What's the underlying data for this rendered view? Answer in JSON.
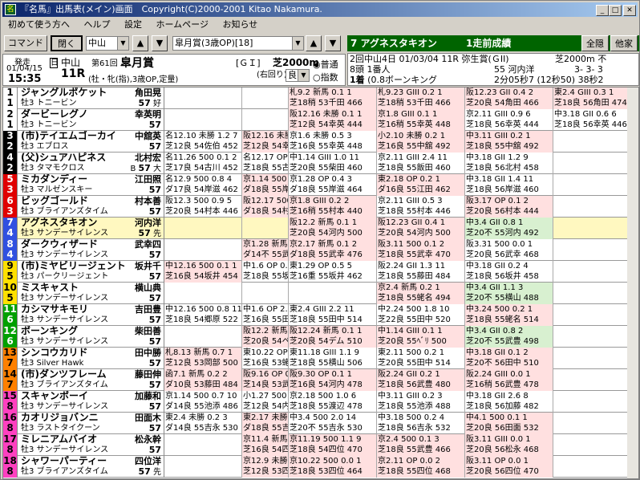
{
  "window": {
    "title": "『名馬』出馬表(メイン)画面　Copyright(C)2000-2001 Kitao Nakamura.",
    "icon": "名"
  },
  "menu": [
    "初めて使う方へ",
    "ヘルプ",
    "設定",
    "ホームページ",
    "お知らせ"
  ],
  "toolbar": {
    "command": "コマンド",
    "close": "閉く",
    "course": "中山",
    "race": "皐月賞(3歳OP)[18]"
  },
  "race": {
    "hassou_label": "発走",
    "date": "01/04/15",
    "time": "15:35",
    "place": "中山",
    "kai": "第61回",
    "name": "皐月賞",
    "day_label": "日",
    "day_value": "11R",
    "grade": "[ＧＩ]",
    "dist": "芝2000m",
    "turn": "(右回り)",
    "cond": "(牡・牝(指),3歳OP,定量)",
    "baba": "良",
    "radio1": "普通",
    "radio2": "指数"
  },
  "horse": {
    "header": "7 アグネスタキオン",
    "result": "1走前成績",
    "btn1": "全隠",
    "btn2": "他家",
    "l1a": "2回中山4日 01/03/04 11R 弥生賞(ＧII)",
    "l1b": "芝2000m 不",
    "l2a": "8頭 1番人",
    "l2b": "55 河内洋",
    "l2c": "3- 3- 3",
    "l3a": "1着",
    "l3b": "(0.8ボーンキング",
    "l3c": "2分05秒7 (12秒50) 38秒2"
  },
  "rows": [
    {
      "no": "1",
      "ban": "1",
      "bc": "#ffffff",
      "fc": "#000000",
      "name": "ジャングルポケット",
      "sex": "牡3 トニービン",
      "jockey": "角田晃",
      "wt": "57",
      "pop": "好",
      "w": "",
      "p": [
        {
          "c": "",
          "a": "",
          "b": ""
        },
        {
          "c": "",
          "a": "",
          "b": ""
        },
        {
          "c": "#ffe0e0",
          "a": "札9.2 新馬 0.1 1",
          "b": "芝18稍 53千田 466"
        },
        {
          "c": "#ffe0e0",
          "a": "札9.23 GIII 0.2 1",
          "b": "芝18稍 53千田 466"
        },
        {
          "c": "#ffe0e0",
          "a": "阪12.23 GII 0.4 2",
          "b": "芝20良 54角田 466"
        },
        {
          "c": "#ffe0e0",
          "a": "東2.4 GIII 0.3 1",
          "b": "芝18良 56角田 474"
        }
      ]
    },
    {
      "no": "2",
      "ban": "1",
      "bc": "#ffffff",
      "fc": "#000000",
      "name": "ダービーレグノ",
      "sex": "牡3 トニービン",
      "jockey": "幸英明",
      "wt": "57",
      "pop": "",
      "w": "",
      "p": [
        {
          "c": "",
          "a": "",
          "b": ""
        },
        {
          "c": "",
          "a": "",
          "b": ""
        },
        {
          "c": "#ffe0e0",
          "a": "阪12.16 未勝 0.1 1",
          "b": "芝12良 54幸英 444"
        },
        {
          "c": "#ffe0e0",
          "a": "京1.8 GIII 0.1 1",
          "b": "芝16稍 55幸英 448"
        },
        {
          "c": "",
          "a": "京2.11 GIII 0.9 6",
          "b": "芝18良 56幸英 444"
        },
        {
          "c": "",
          "a": "中3.18 GII 0.6 6",
          "b": "芝18良 56幸英 446"
        }
      ]
    },
    {
      "no": "3",
      "ban": "2",
      "bc": "#000000",
      "fc": "#ffffff",
      "name": "(市)テイエムゴーカイ",
      "sex": "牡3 エブロス",
      "jockey": "中舘英",
      "wt": "57",
      "pop": "",
      "w": "",
      "p": [
        {
          "c": "",
          "a": "名12.10 未勝 1.2 7",
          "b": "芝12良 54佐伯 452"
        },
        {
          "c": "#ffe0e0",
          "a": "阪12.16 未勝 0.1 1",
          "b": "芝12良 54幸英 444"
        },
        {
          "c": "",
          "a": "京1.6 未勝 0.5 3",
          "b": "芝16良 55幸英 448"
        },
        {
          "c": "#ffe0e0",
          "a": "小2.10 未勝 0.2 1",
          "b": "芝16良 55中舘 492"
        },
        {
          "c": "#ffe0e0",
          "a": "中3.11 GIII 0.2 1",
          "b": "芝18良 55中舘 492"
        },
        {
          "c": "",
          "a": "",
          "b": ""
        }
      ]
    },
    {
      "no": "4",
      "ban": "2",
      "bc": "#000000",
      "fc": "#ffffff",
      "name": "(父)シュアハピネス",
      "sex": "牡3 タマモクロス",
      "jockey": "北村宏",
      "wt": "57",
      "pop": "大",
      "w": "B",
      "p": [
        {
          "c": "",
          "a": "名11.26 500 0.1 2",
          "b": "芝17良 54古川 452"
        },
        {
          "c": "",
          "a": "名12.17 OP 1.0 12",
          "b": "芝18良 55古川 460"
        },
        {
          "c": "",
          "a": "中1.14 GIII 1.0 11",
          "b": "芝20良 55柴田 460"
        },
        {
          "c": "",
          "a": "京2.11 GIII 2.4 11",
          "b": "芝18良 55飯田 460"
        },
        {
          "c": "",
          "a": "中3.18 GII 1.2 9",
          "b": "芝18良 56北村 458"
        },
        {
          "c": "",
          "a": "",
          "b": ""
        }
      ]
    },
    {
      "no": "5",
      "ban": "3",
      "bc": "#e00000",
      "fc": "#ffffff",
      "name": "ミカダンディー",
      "sex": "牡3 マルゼンスキー",
      "jockey": "江田照",
      "wt": "57",
      "pop": "",
      "w": "",
      "p": [
        {
          "c": "",
          "a": "名12.9 500 0.8 4",
          "b": "ダ17良 54岸滋 462"
        },
        {
          "c": "#ffe0e0",
          "a": "京1.14 500 0.0 1",
          "b": "ダ18良 55岸滋 468"
        },
        {
          "c": "",
          "a": "京1.28 OP 0.4 3",
          "b": "ダ18良 55岸滋 464"
        },
        {
          "c": "#ffe0e0",
          "a": "東2.18 OP 0.2 1",
          "b": "ダ16良 55江田 462"
        },
        {
          "c": "",
          "a": "中3.18 GII 1.4 11",
          "b": "芝18良 56岸滋 460"
        },
        {
          "c": "",
          "a": "",
          "b": ""
        }
      ]
    },
    {
      "no": "6",
      "ban": "3",
      "bc": "#e00000",
      "fc": "#ffffff",
      "name": "ビッグゴールド",
      "sex": "牡3 ブライアンズタイム",
      "jockey": "村本善",
      "wt": "57",
      "pop": "",
      "w": "",
      "p": [
        {
          "c": "",
          "a": "阪12.3 500 0.9 5",
          "b": "芝20良 54村本 446"
        },
        {
          "c": "#ffe0e0",
          "a": "阪12.17 500 0.2 1",
          "b": "ダ18良 54村本 448"
        },
        {
          "c": "#ffe0e0",
          "a": "京1.8 GIII 0.2 2",
          "b": "芝16稍 55村本 440"
        },
        {
          "c": "",
          "a": "京2.11 GIII 0.5 3",
          "b": "芝18良 55村本 446"
        },
        {
          "c": "#ffe0e0",
          "a": "阪3.17 OP 0.1 2",
          "b": "芝20良 56村本 444"
        },
        {
          "c": "",
          "a": "",
          "b": ""
        }
      ]
    },
    {
      "no": "7",
      "ban": "4",
      "bc": "#3050e0",
      "fc": "#ffffff",
      "name": "アグネスタキオン",
      "sex": "牡3 サンデーサイレンス",
      "jockey": "河内洋",
      "wt": "57",
      "pop": "先",
      "w": "",
      "hl": true,
      "p": [
        {
          "c": "",
          "a": "",
          "b": ""
        },
        {
          "c": "",
          "a": "",
          "b": ""
        },
        {
          "c": "#ffe0e0",
          "a": "阪12.2 新馬 0.1 1",
          "b": "芝20良 54河内 500"
        },
        {
          "c": "#ffe0e0",
          "a": "阪12.23 GII 0.4 1",
          "b": "芝20良 54河内 500"
        },
        {
          "c": "#d8f0d0",
          "a": "中3.4 GII 0.8 1",
          "b": "芝20不 55河内 492"
        },
        {
          "c": "",
          "a": "",
          "b": ""
        }
      ]
    },
    {
      "no": "8",
      "ban": "4",
      "bc": "#3050e0",
      "fc": "#ffffff",
      "name": "ダークウィザード",
      "sex": "牡3 サンデーサイレンス",
      "jockey": "武幸四",
      "wt": "57",
      "pop": "",
      "w": "",
      "p": [
        {
          "c": "",
          "a": "",
          "b": ""
        },
        {
          "c": "#ffe0e0",
          "a": "京1.28 新馬 0.1 2",
          "b": "ダ14不 55武幸 476"
        },
        {
          "c": "#ffe0e0",
          "a": "京2.17 新馬 0.1 2",
          "b": "ダ18良 55武幸 476"
        },
        {
          "c": "#ffe0e0",
          "a": "阪3.11 500 0.1 2",
          "b": "芝18良 55武幸 470"
        },
        {
          "c": "",
          "a": "阪3.31 500 0.0 1",
          "b": "芝20良 56武幸 468"
        },
        {
          "c": "",
          "a": "",
          "b": ""
        }
      ]
    },
    {
      "no": "9",
      "ban": "5",
      "bc": "#ffe000",
      "fc": "#000000",
      "name": "(市)ミヤビリージェント",
      "sex": "牡3 パークリージェント",
      "jockey": "坂井千",
      "wt": "57",
      "pop": "",
      "w": "",
      "p": [
        {
          "c": "#ffe0e0",
          "a": "中12.16 500 0.1 1",
          "b": "芝16良 54坂井 454"
        },
        {
          "c": "",
          "a": "中1.6 OP 0.1 4",
          "b": "芝18良 55坂井 460"
        },
        {
          "c": "",
          "a": "東1.29 OP 0.5 5",
          "b": "芝16重 55坂井 462"
        },
        {
          "c": "",
          "a": "阪2.24 GII 1.3 11",
          "b": "芝18良 55藤田 484"
        },
        {
          "c": "",
          "a": "中3.18 GII 0.2 4",
          "b": "芝18良 56坂井 458"
        },
        {
          "c": "",
          "a": "",
          "b": ""
        }
      ]
    },
    {
      "no": "10",
      "ban": "5",
      "bc": "#ffe000",
      "fc": "#000000",
      "name": "ミスキャスト",
      "sex": "牡3 サンデーサイレンス",
      "jockey": "横山典",
      "wt": "57",
      "pop": "",
      "w": "",
      "p": [
        {
          "c": "",
          "a": "",
          "b": ""
        },
        {
          "c": "",
          "a": "",
          "b": ""
        },
        {
          "c": "",
          "a": "",
          "b": ""
        },
        {
          "c": "#ffe0e0",
          "a": "京2.4 新馬 0.2 1",
          "b": "芝18良 55蛯名 494"
        },
        {
          "c": "#d8f0d0",
          "a": "中3.4 GII 1.1 3",
          "b": "芝20不 55横山 488"
        },
        {
          "c": "",
          "a": "",
          "b": ""
        }
      ]
    },
    {
      "no": "11",
      "ban": "6",
      "bc": "#00a000",
      "fc": "#ffffff",
      "name": "カシマサキモリ",
      "sex": "牡3 サンデーサイレンス",
      "jockey": "吉田豊",
      "wt": "57",
      "pop": "",
      "w": "",
      "p": [
        {
          "c": "",
          "a": "中12.16 500 0.8 11",
          "b": "芝18良 54郷原 522"
        },
        {
          "c": "",
          "a": "中1.6 OP 2.0 14",
          "b": "芝16良 55田中 520"
        },
        {
          "c": "",
          "a": "東2.4 GIII 2.2 11",
          "b": "芝18良 55田中 514"
        },
        {
          "c": "",
          "a": "中2.24 500 1.8 10",
          "b": "芝22良 55田中 520"
        },
        {
          "c": "#ffe0e0",
          "a": "中3.24 500 0.2 1",
          "b": "芝18良 55蛯名 514"
        },
        {
          "c": "",
          "a": "",
          "b": ""
        }
      ]
    },
    {
      "no": "12",
      "ban": "6",
      "bc": "#00a000",
      "fc": "#ffffff",
      "name": "ボーンキング",
      "sex": "牡3 サンデーサイレンス",
      "jockey": "柴田善",
      "wt": "57",
      "pop": "",
      "w": "",
      "p": [
        {
          "c": "",
          "a": "",
          "b": ""
        },
        {
          "c": "#ffe0e0",
          "a": "阪12.2 新馬 2.0 5",
          "b": "芝20良 54ペリ 508"
        },
        {
          "c": "#ffe0e0",
          "a": "阪12.24 新馬 0.1 1",
          "b": "芝20良 54デム 510"
        },
        {
          "c": "#ffe0e0",
          "a": "中1.14 GIII 0.1 1",
          "b": "芝20良 55ﾍﾞﾘ 500"
        },
        {
          "c": "#d8f0d0",
          "a": "中3.4 GII 0.8 2",
          "b": "芝20不 55武豊 498"
        },
        {
          "c": "",
          "a": "",
          "b": ""
        }
      ]
    },
    {
      "no": "13",
      "ban": "7",
      "bc": "#ff8000",
      "fc": "#000000",
      "name": "シンコウカリド",
      "sex": "牡3 Silver Hawk",
      "jockey": "田中勝",
      "wt": "57",
      "pop": "",
      "w": "",
      "p": [
        {
          "c": "#ffe0e0",
          "a": "札8.13 新馬 0.7 1",
          "b": "芝12良 53岡部 500"
        },
        {
          "c": "",
          "a": "東10.22 OP 0.1 3",
          "b": "芝16良 53蛯名 508"
        },
        {
          "c": "",
          "a": "東11.18 GIII 1.1 9",
          "b": "芝18良 55横山 506"
        },
        {
          "c": "",
          "a": "東2.11 500 0.2 1",
          "b": "芝20良 55田中 514"
        },
        {
          "c": "#ffe0e0",
          "a": "中3.18 GII 0.1 2",
          "b": "芝20不 56田中 510"
        },
        {
          "c": "",
          "a": "",
          "b": ""
        }
      ]
    },
    {
      "no": "14",
      "ban": "7",
      "bc": "#ff8000",
      "fc": "#000000",
      "name": "(市)ダンツフレーム",
      "sex": "牡3 ブライアンズタイム",
      "jockey": "藤田伸",
      "wt": "57",
      "pop": "",
      "w": "",
      "p": [
        {
          "c": "#ffe0e0",
          "a": "函7.1 新馬 0.2 2",
          "b": "ダ10良 53藤田 484"
        },
        {
          "c": "#ffe0e0",
          "a": "阪9.16 OP 0.0 2",
          "b": "芝14良 53武豊 482"
        },
        {
          "c": "#ffe0e0",
          "a": "阪9.30 OP 0.1 1",
          "b": "芝16良 54河内 478"
        },
        {
          "c": "#ffe0e0",
          "a": "阪2.24 GII 0.2 1",
          "b": "芝18良 56武豊 480"
        },
        {
          "c": "#ffe0e0",
          "a": "阪2.24 GIII 0.0 1",
          "b": "芝16稍 56武豊 478"
        },
        {
          "c": "",
          "a": "",
          "b": ""
        }
      ]
    },
    {
      "no": "15",
      "ban": "8",
      "bc": "#ff40c0",
      "fc": "#000000",
      "name": "スキャンボーイ",
      "sex": "牡3 サンデーサイレンス",
      "jockey": "加藤和",
      "wt": "57",
      "pop": "",
      "w": "",
      "p": [
        {
          "c": "",
          "a": "京1.14 500 0.7 10",
          "b": "ダ14良 55池添 486"
        },
        {
          "c": "",
          "a": "小1.27 500 2.6 6",
          "b": "芝12良 54内田 486"
        },
        {
          "c": "",
          "a": "京2.18 500 1.0 6",
          "b": "芝18良 55渡辺 478"
        },
        {
          "c": "",
          "a": "中3.11 GIII 0.2 3",
          "b": "芝18良 55池添 488"
        },
        {
          "c": "",
          "a": "中3.18 GII 2.6 8",
          "b": "芝18良 56加藤 482"
        },
        {
          "c": "",
          "a": "",
          "b": ""
        }
      ]
    },
    {
      "no": "16",
      "ban": "8",
      "bc": "#ff40c0",
      "fc": "#000000",
      "name": "カオリジョバンニ",
      "sex": "牡3 ラストタイクーン",
      "jockey": "田面木",
      "wt": "57",
      "pop": "",
      "w": "",
      "p": [
        {
          "c": "",
          "a": "東2.4 未勝 0.2 3",
          "b": "ダ14良 55吉永 530"
        },
        {
          "c": "#ffe0e0",
          "a": "東2.17 未勝 0.0 1",
          "b": "ダ18良 55吉永 530"
        },
        {
          "c": "",
          "a": "中3.4 500 2.0 14",
          "b": "芝20不 55吉永 530"
        },
        {
          "c": "",
          "a": "中3.18 500 0.2 4",
          "b": "芝18良 56吉永 532"
        },
        {
          "c": "#ffe0e0",
          "a": "中4.1 500 0.1 1",
          "b": "芝20良 56田面 532"
        },
        {
          "c": "",
          "a": "",
          "b": ""
        }
      ]
    },
    {
      "no": "17",
      "ban": "8",
      "bc": "#ff40c0",
      "fc": "#000000",
      "name": "ミレニアムバイオ",
      "sex": "牡3 サンデーサイレンス",
      "jockey": "松永幹",
      "wt": "57",
      "pop": "",
      "w": "",
      "p": [
        {
          "c": "",
          "a": "",
          "b": ""
        },
        {
          "c": "#ffe0e0",
          "a": "京11.4 新馬 0.1 2",
          "b": "芝16良 54四位 464"
        },
        {
          "c": "#ffe0e0",
          "a": "京11.19 500 1.1 9",
          "b": "芝18良 54四位 470"
        },
        {
          "c": "#ffe0e0",
          "a": "京2.4 500 0.1 3",
          "b": "芝18良 55武豊 466"
        },
        {
          "c": "#ffe0e0",
          "a": "阪3.11 GIII 0.0 1",
          "b": "芝20良 56松永 468"
        },
        {
          "c": "",
          "a": "",
          "b": ""
        }
      ]
    },
    {
      "no": "18",
      "ban": "8",
      "bc": "#ff40c0",
      "fc": "#000000",
      "name": "シャワーパーティー",
      "sex": "牡3 ブライアンズタイム",
      "jockey": "四位洋",
      "wt": "57",
      "pop": "先",
      "w": "",
      "p": [
        {
          "c": "",
          "a": "",
          "b": ""
        },
        {
          "c": "#ffe0e0",
          "a": "京12.9 未勝 0.0 1",
          "b": "芝12良 53四位 464"
        },
        {
          "c": "#ffe0e0",
          "a": "京10.22 500 0.0 1",
          "b": "芝18良 53四位 464"
        },
        {
          "c": "#ffe0e0",
          "a": "京2.11 OP 0.0 2",
          "b": "芝18良 55四位 468"
        },
        {
          "c": "#ffe0e0",
          "a": "阪3.11 OP 0.0 1",
          "b": "芝20良 56四位 470"
        },
        {
          "c": "",
          "a": "",
          "b": ""
        }
      ]
    }
  ]
}
